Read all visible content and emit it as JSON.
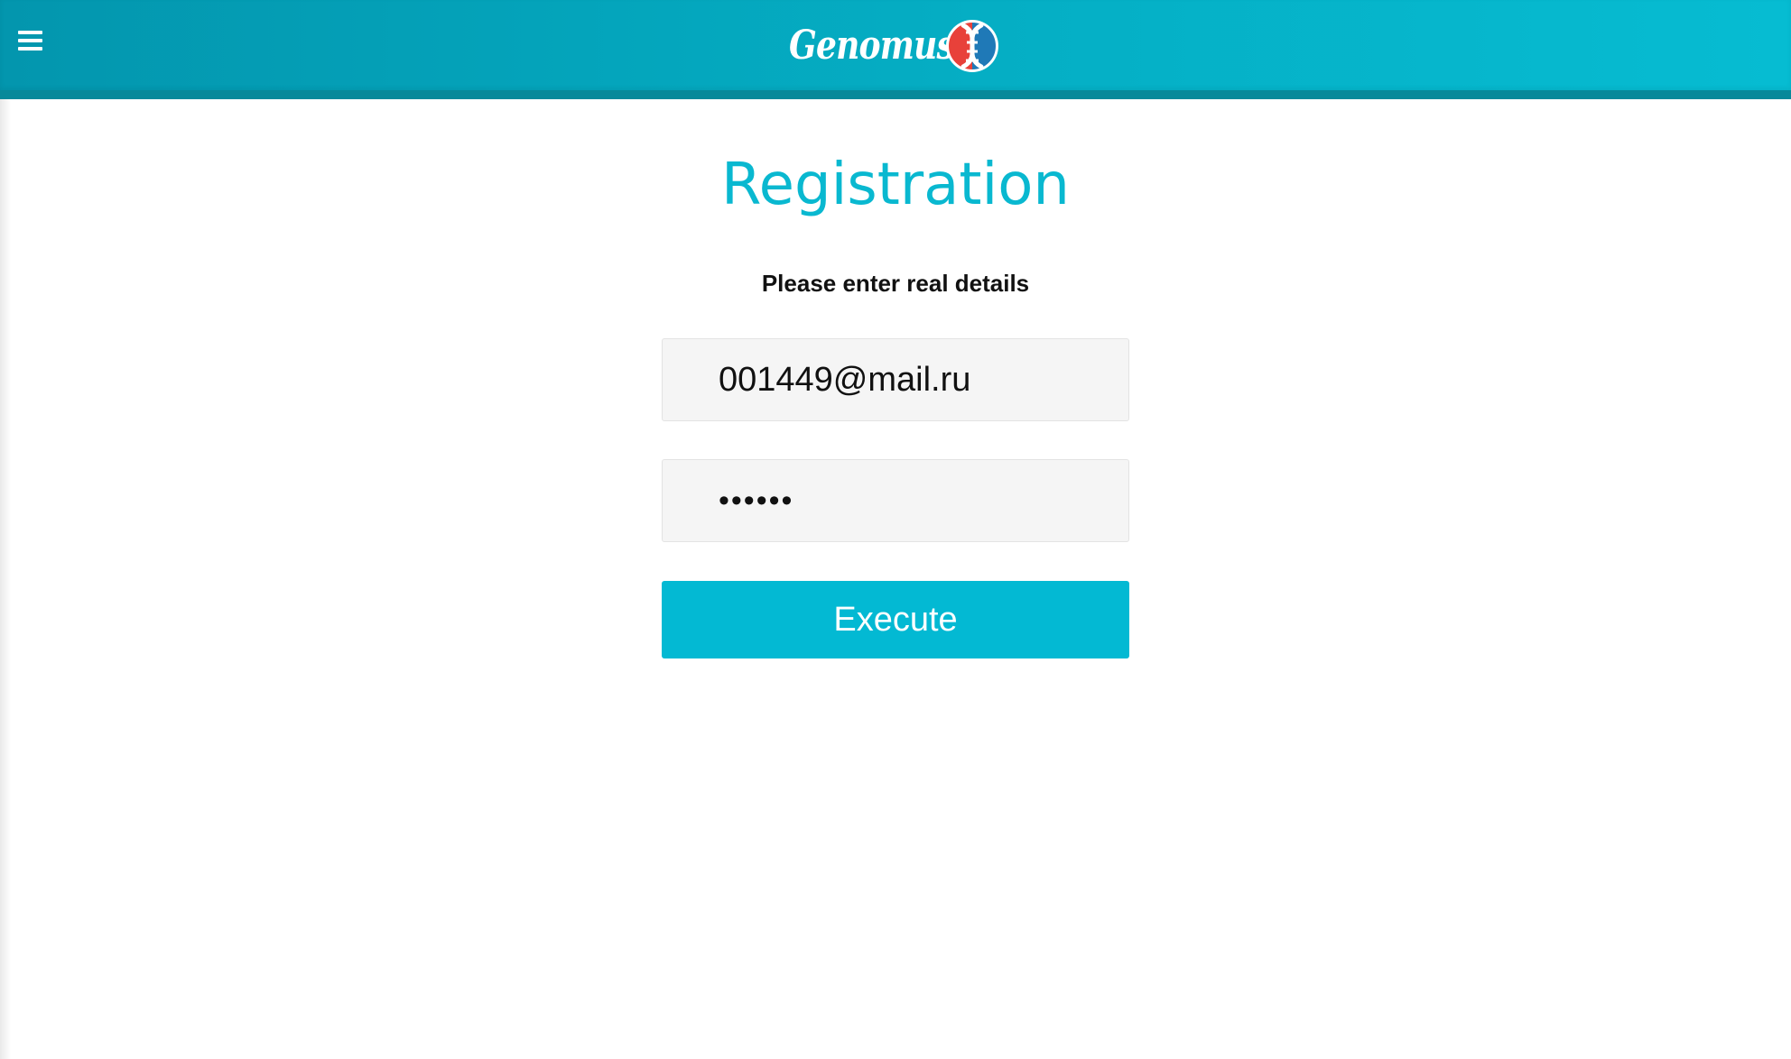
{
  "header": {
    "brand": "Genomus",
    "menu_icon": "hamburger-menu-icon",
    "logo_icon": "dna-icon",
    "colors": {
      "header_start": "#0396ae",
      "header_end": "#06bcd2",
      "header_border": "#07899a",
      "logo_red": "#e8413a",
      "logo_blue": "#1f79b7"
    }
  },
  "main": {
    "title": "Registration",
    "subtitle": "Please enter real details",
    "email_value": "001449@mail.ru",
    "password_value": "123456",
    "button_label": "Execute",
    "colors": {
      "title": "#09b8d0",
      "button": "#03b9d3",
      "field_bg": "#f5f5f5"
    }
  }
}
